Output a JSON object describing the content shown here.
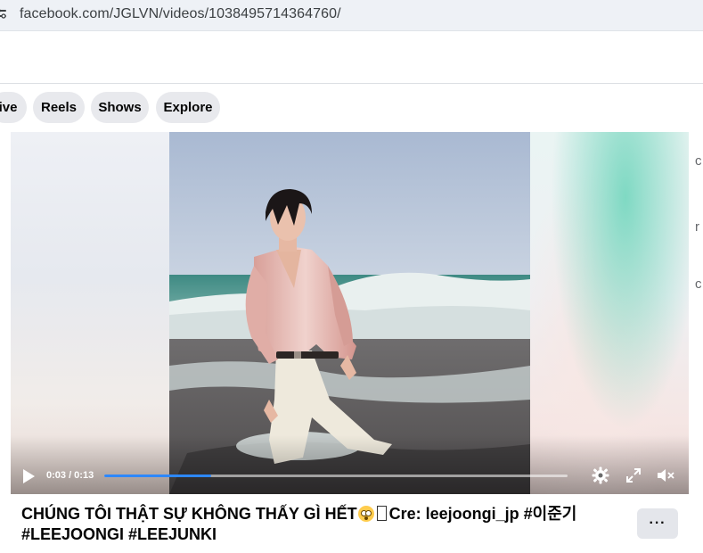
{
  "browser": {
    "url": "facebook.com/JGLVN/videos/1038495714364760/"
  },
  "tabs": [
    {
      "label": "ive"
    },
    {
      "label": "Reels"
    },
    {
      "label": "Shows"
    },
    {
      "label": "Explore"
    }
  ],
  "player": {
    "time_display": "0:03 / 0:13",
    "progress_fraction": 0.23
  },
  "post": {
    "caption_line1_part1": "CHÚNG TÔI THẬT SỰ KHÔNG THẤY GÌ HẾT",
    "caption_line1_part2": "Cre: leejoongi_jp #이준기",
    "caption_line2": "#LEEJOONGI #LEEJUNKI",
    "more_label": "···"
  },
  "colors": {
    "accent": "#2d88ff",
    "tab_bg": "#e8e9ed",
    "address_bar_bg": "#eef1f6"
  }
}
